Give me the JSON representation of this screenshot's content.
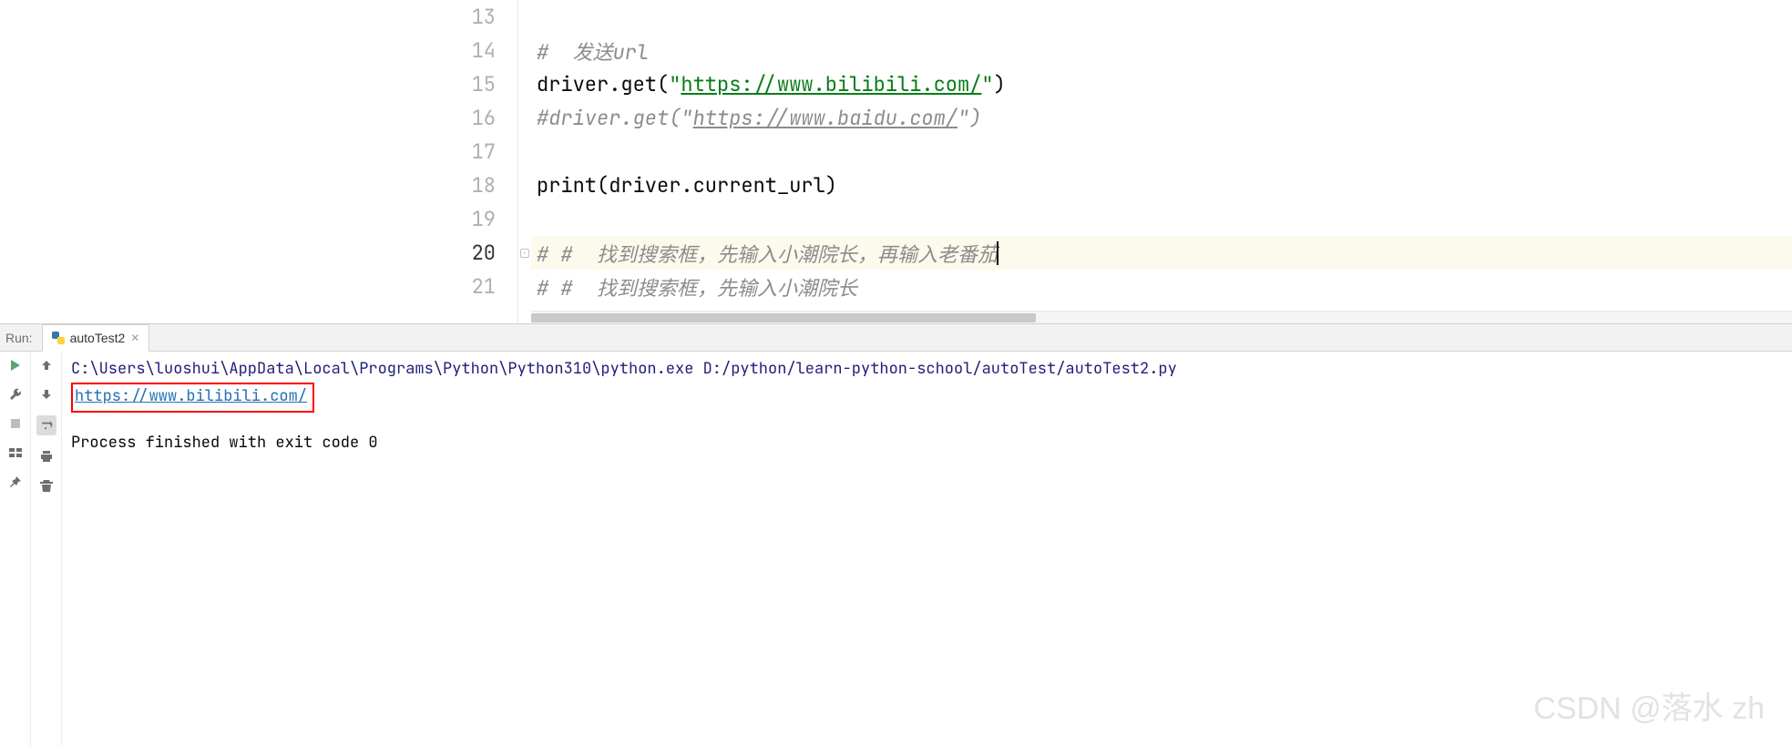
{
  "editor": {
    "lines": [
      {
        "num": "13",
        "parts": []
      },
      {
        "num": "14",
        "parts": [
          {
            "cls": "tok-comment",
            "t": "#  发送url"
          }
        ]
      },
      {
        "num": "15",
        "parts": [
          {
            "cls": "",
            "t": "driver.get("
          },
          {
            "cls": "tok-str",
            "t": "\""
          },
          {
            "cls": "tok-url",
            "t": "https://www.bilibili.com/"
          },
          {
            "cls": "tok-str",
            "t": "\""
          },
          {
            "cls": "",
            "t": ")"
          }
        ]
      },
      {
        "num": "16",
        "parts": [
          {
            "cls": "tok-comment",
            "t": "#driver.get(\""
          },
          {
            "cls": "tok-url-comment",
            "t": "https://www.baidu.com/"
          },
          {
            "cls": "tok-comment",
            "t": "\")"
          }
        ]
      },
      {
        "num": "17",
        "parts": []
      },
      {
        "num": "18",
        "parts": [
          {
            "cls": "",
            "t": "print(driver.current_url)"
          }
        ]
      },
      {
        "num": "19",
        "parts": []
      },
      {
        "num": "20",
        "active": true,
        "fold": true,
        "caret": true,
        "parts": [
          {
            "cls": "tok-comment",
            "t": "# #  找到搜索框，先输入小潮院长，再输入老番茄"
          }
        ]
      },
      {
        "num": "21",
        "parts": [
          {
            "cls": "tok-comment",
            "t": "# #  找到搜索框，先输入小潮院长"
          }
        ]
      }
    ]
  },
  "run": {
    "label": "Run:",
    "tab": "autoTest2",
    "cmd": "C:\\Users\\luoshui\\AppData\\Local\\Programs\\Python\\Python310\\python.exe D:/python/learn-python-school/autoTest/autoTest2.py",
    "out_link": "https://www.bilibili.com/",
    "exit": "Process finished with exit code 0"
  },
  "watermark": "CSDN @落水 zh"
}
